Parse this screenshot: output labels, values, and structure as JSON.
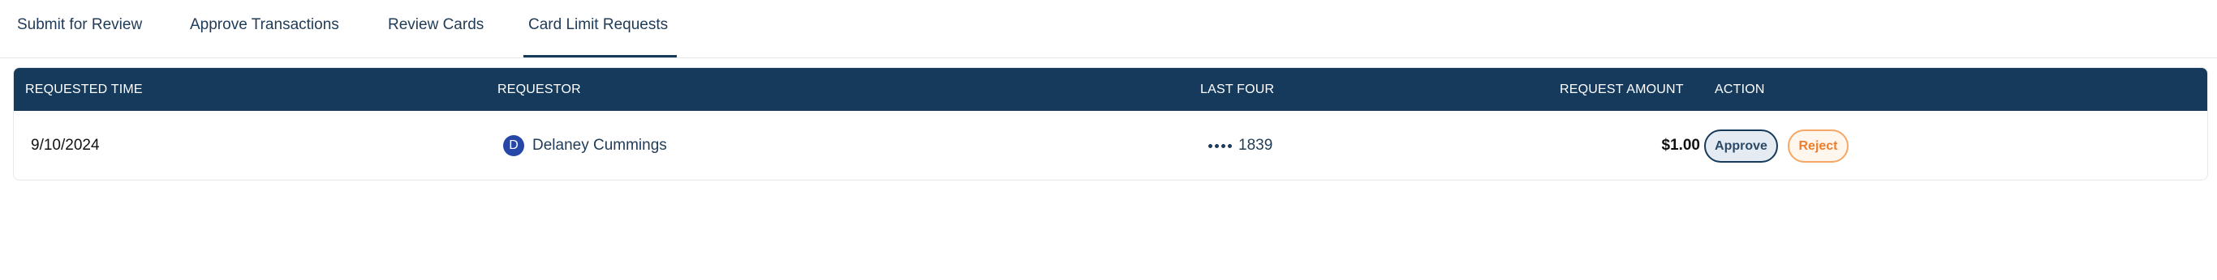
{
  "tabs": [
    {
      "label": "Submit for Review"
    },
    {
      "label": "Approve Transactions"
    },
    {
      "label": "Review Cards"
    },
    {
      "label": "Card Limit Requests",
      "active": true
    }
  ],
  "table": {
    "columns": {
      "requested_time": "REQUESTED TIME",
      "requestor": "REQUESTOR",
      "last_four": "LAST FOUR",
      "request_amount": "REQUEST AMOUNT",
      "action": "ACTION"
    },
    "rows": [
      {
        "requested_time": "9/10/2024",
        "avatar_initial": "D",
        "requestor": "Delaney Cummings",
        "last_four": "1839",
        "request_amount": "$1.00",
        "approve_label": "Approve",
        "reject_label": "Reject"
      }
    ]
  },
  "colors": {
    "header_bg": "#153a5b",
    "accent_orange": "#ef7e2a",
    "avatar_bg": "#2747a8"
  },
  "icons": {
    "masked_digits": "masked-card-dots-icon"
  }
}
